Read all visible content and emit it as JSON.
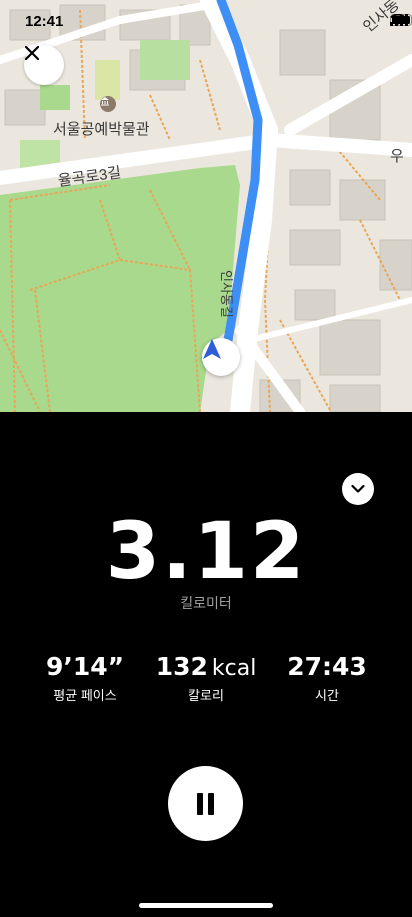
{
  "status_bar": {
    "time": "12:41"
  },
  "map": {
    "labels": {
      "museum": "서울공예박물관",
      "road": "율곡로3길",
      "insadong": "인사동",
      "east_edge": "우",
      "vertical_street": "인사동길"
    },
    "icons": {
      "close": "close-icon",
      "museum": "museum-icon",
      "navigation": "navigation-arrow-icon"
    },
    "colors": {
      "route": "#3d8ff5",
      "park": "#a8d98c",
      "arrow": "#2f5ed8"
    }
  },
  "workout": {
    "distance": {
      "value": "3.12",
      "unit": "킬로미터"
    },
    "stats": [
      {
        "value": "9’14”",
        "unit": "",
        "label": "평균 페이스"
      },
      {
        "value": "132",
        "unit": "kcal",
        "label": "칼로리"
      },
      {
        "value": "27:43",
        "unit": "",
        "label": "시간"
      }
    ],
    "controls": {
      "collapse_icon": "chevron-down-icon",
      "pause_icon": "pause-icon"
    }
  }
}
